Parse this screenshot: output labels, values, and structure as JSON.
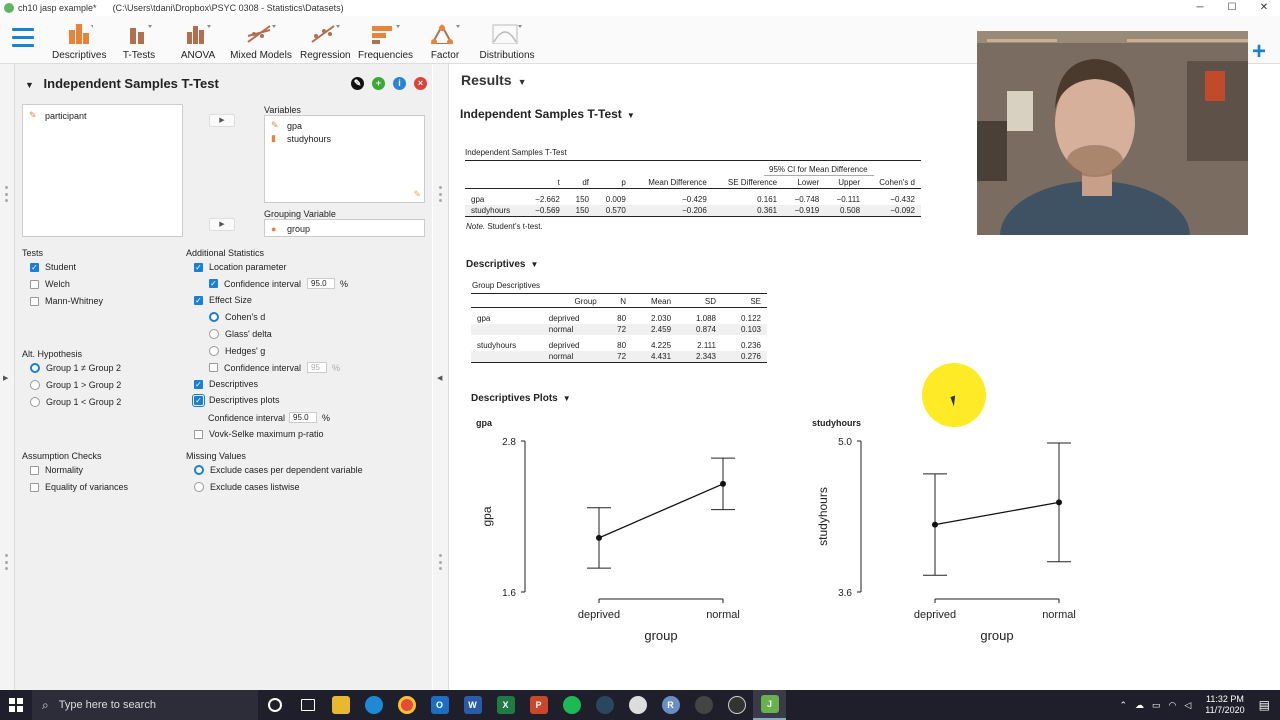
{
  "window": {
    "title": "ch10 jasp example*",
    "path": "(C:\\Users\\tdani\\Dropbox\\PSYC 0308 - Statistics\\Datasets)",
    "minimize": "─",
    "maximize": "☐",
    "close": "✕"
  },
  "ribbon": {
    "items": [
      {
        "label": "Descriptives",
        "icon": "descriptives-icon"
      },
      {
        "label": "T-Tests",
        "icon": "ttests-icon"
      },
      {
        "label": "ANOVA",
        "icon": "anova-icon"
      },
      {
        "label": "Mixed Models",
        "icon": "mixed-models-icon"
      },
      {
        "label": "Regression",
        "icon": "regression-icon"
      },
      {
        "label": "Frequencies",
        "icon": "frequencies-icon"
      },
      {
        "label": "Factor",
        "icon": "factor-icon"
      },
      {
        "label": "Distributions",
        "icon": "distributions-icon"
      }
    ],
    "plus": "+"
  },
  "analysis": {
    "title": "Independent Samples T-Test",
    "source_vars": [
      "participant"
    ],
    "variables_label": "Variables",
    "variables": [
      "gpa",
      "studyhours"
    ],
    "grouping_label": "Grouping Variable",
    "grouping_value": "group",
    "tests": {
      "label": "Tests",
      "items": [
        {
          "label": "Student",
          "checked": true
        },
        {
          "label": "Welch",
          "checked": false
        },
        {
          "label": "Mann-Whitney",
          "checked": false
        }
      ]
    },
    "alt_hypothesis": {
      "label": "Alt. Hypothesis",
      "items": [
        {
          "label": "Group 1 ≠ Group 2",
          "selected": true
        },
        {
          "label": "Group 1 > Group 2",
          "selected": false
        },
        {
          "label": "Group 1 < Group 2",
          "selected": false
        }
      ]
    },
    "assumption_checks": {
      "label": "Assumption Checks",
      "items": [
        {
          "label": "Normality",
          "checked": false
        },
        {
          "label": "Equality of variances",
          "checked": false
        }
      ]
    },
    "additional": {
      "label": "Additional Statistics",
      "location_parameter": "Location parameter",
      "confidence_interval": "Confidence interval",
      "ci_value": "95.0",
      "percent": "%",
      "effect_size": "Effect Size",
      "cohens_d": "Cohen's d",
      "glass_delta": "Glass' delta",
      "hedges_g": "Hedges' g",
      "es_ci_label": "Confidence interval",
      "es_ci_value": "95",
      "descriptives": "Descriptives",
      "descriptives_plots": "Descriptives plots",
      "plot_ci_label": "Confidence interval",
      "plot_ci_value": "95.0",
      "vovk": "Vovk-Selke maximum p-ratio"
    },
    "missing": {
      "label": "Missing Values",
      "exclude_dependent": "Exclude cases per dependent variable",
      "exclude_listwise": "Exclude cases listwise"
    }
  },
  "results": {
    "title": "Results",
    "analysis_title": "Independent Samples T-Test",
    "ttest_table": {
      "caption": "Independent Samples T-Test",
      "ci_header": "95% CI for Mean Difference",
      "columns": [
        "",
        "t",
        "df",
        "p",
        "Mean Difference",
        "SE Difference",
        "Lower",
        "Upper",
        "Cohen's d"
      ],
      "rows": [
        [
          "gpa",
          "−2.662",
          "150",
          "0.009",
          "−0.429",
          "0.161",
          "−0.748",
          "−0.111",
          "−0.432"
        ],
        [
          "studyhours",
          "−0.569",
          "150",
          "0.570",
          "−0.206",
          "0.361",
          "−0.919",
          "0.508",
          "−0.092"
        ]
      ],
      "note_label": "Note.",
      "note_text": "Student's t-test."
    },
    "descriptives_title": "Descriptives",
    "group_table": {
      "caption": "Group Descriptives",
      "columns": [
        "",
        "Group",
        "N",
        "Mean",
        "SD",
        "SE"
      ],
      "rows": [
        [
          "gpa",
          "deprived",
          "80",
          "2.030",
          "1.088",
          "0.122"
        ],
        [
          "",
          "normal",
          "72",
          "2.459",
          "0.874",
          "0.103"
        ],
        [
          "studyhours",
          "deprived",
          "80",
          "4.225",
          "2.111",
          "0.236"
        ],
        [
          "",
          "normal",
          "72",
          "4.431",
          "2.343",
          "0.276"
        ]
      ]
    },
    "plots_title": "Descriptives Plots"
  },
  "chart_data": [
    {
      "type": "line",
      "title": "gpa",
      "xlabel": "group",
      "ylabel": "gpa",
      "categories": [
        "deprived",
        "normal"
      ],
      "values": [
        2.03,
        2.459
      ],
      "ci_lower": [
        1.79,
        2.255
      ],
      "ci_upper": [
        2.27,
        2.664
      ],
      "ylim": [
        1.6,
        2.8
      ],
      "yticks": [
        "1.6",
        "2.8"
      ]
    },
    {
      "type": "line",
      "title": "studyhours",
      "xlabel": "group",
      "ylabel": "studyhours",
      "categories": [
        "deprived",
        "normal"
      ],
      "values": [
        4.225,
        4.431
      ],
      "ci_lower": [
        3.755,
        3.88
      ],
      "ci_upper": [
        4.695,
        4.982
      ],
      "ylim": [
        3.6,
        5.0
      ],
      "yticks": [
        "3.6",
        "5.0"
      ]
    }
  ],
  "taskbar": {
    "search_placeholder": "Type here to search",
    "time": "11:32 PM",
    "date": "11/7/2020"
  }
}
